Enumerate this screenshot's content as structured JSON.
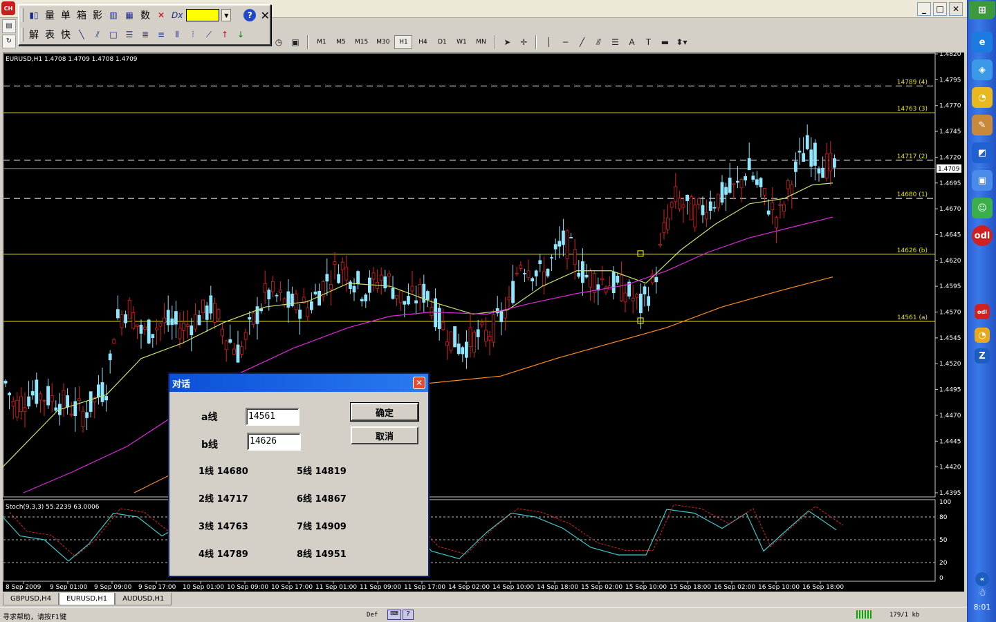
{
  "float_toolbar": {
    "row1": [
      "量",
      "单",
      "箱",
      "影",
      "数"
    ],
    "row2": [
      "解",
      "表",
      "快"
    ],
    "color": "#ffff00"
  },
  "timeframes": [
    "M1",
    "M5",
    "M15",
    "M30",
    "H1",
    "H4",
    "D1",
    "W1",
    "MN"
  ],
  "active_timeframe": "H1",
  "chart": {
    "header": "EURUSD,H1  1.4708 1.4709 1.4708 1.4709",
    "price_labels": [
      "1.4820",
      "1.4795",
      "1.4770",
      "1.4745",
      "1.4720",
      "1.4695",
      "1.4670",
      "1.4645",
      "1.4620",
      "1.4595",
      "1.4570",
      "1.4545",
      "1.4520",
      "1.4495",
      "1.4470",
      "1.4445",
      "1.4420",
      "1.4395"
    ],
    "current_price": "1.4709",
    "levels": [
      {
        "label": "14789 (4)",
        "price": 1.4789,
        "style": "dashed",
        "color": "#ffffff"
      },
      {
        "label": "14763 (3)",
        "price": 1.4763,
        "style": "solid",
        "color": "#e6e600"
      },
      {
        "label": "14717 (2)",
        "price": 1.4717,
        "style": "dashed",
        "color": "#ffffff"
      },
      {
        "label": "14680 (1)",
        "price": 1.468,
        "style": "dashed",
        "color": "#ffffff"
      },
      {
        "label": "14626 (b)",
        "price": 1.4626,
        "style": "solid",
        "color": "#e6e600"
      },
      {
        "label": "14561 (a)",
        "price": 1.4561,
        "style": "solid",
        "color": "#e6e600"
      }
    ],
    "time_labels": [
      "8 Sep 2009",
      "9 Sep 01:00",
      "9 Sep 09:00",
      "9 Sep 17:00",
      "10 Sep 01:00",
      "10 Sep 09:00",
      "10 Sep 17:00",
      "11 Sep 01:00",
      "11 Sep 09:00",
      "11 Sep 17:00",
      "14 Sep 02:00",
      "14 Sep 10:00",
      "14 Sep 18:00",
      "15 Sep 02:00",
      "15 Sep 10:00",
      "15 Sep 18:00",
      "16 Sep 02:00",
      "16 Sep 10:00",
      "16 Sep 18:00"
    ],
    "stoch_header": "Stoch(9,3,3) 55.2239 63.0006",
    "stoch_levels": [
      "100",
      "80",
      "50",
      "20",
      "0"
    ]
  },
  "tabs": [
    {
      "label": "GBPUSD,H4",
      "active": false
    },
    {
      "label": "EURUSD,H1",
      "active": true
    },
    {
      "label": "AUDUSD,H1",
      "active": false
    }
  ],
  "status": {
    "help": "寻求帮助，请按F1键",
    "profile": "Def",
    "traffic": "179/1 kb"
  },
  "clock": "8:01",
  "dialog": {
    "title": "对话",
    "a_label": "a线",
    "a_value": "14561",
    "b_label": "b线",
    "b_value": "14626",
    "ok": "确定",
    "cancel": "取消",
    "lines": [
      "1线 14680",
      "5线 14819",
      "2线 14717",
      "6线 14867",
      "3线 14763",
      "7线 14909",
      "4线 14789",
      "8线 14951"
    ]
  }
}
